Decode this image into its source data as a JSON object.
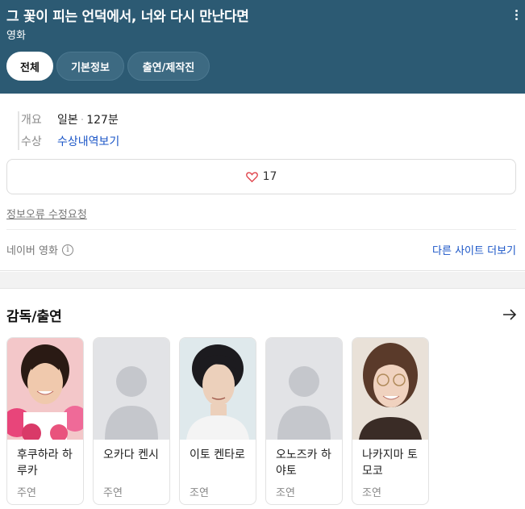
{
  "header": {
    "title": "그 꽃이 피는 언덕에서, 너와 다시 만난다면",
    "subtitle": "영화",
    "tabs": [
      {
        "label": "전체",
        "active": true
      },
      {
        "label": "기본정보",
        "active": false
      },
      {
        "label": "출연/제작진",
        "active": false
      }
    ]
  },
  "info": {
    "overview_key": "개요",
    "country": "일본",
    "separator": "·",
    "runtime": "127분",
    "award_key": "수상",
    "award_link": "수상내역보기",
    "likes": "17",
    "report_link": "정보오류 수정요청",
    "source": "네이버 영화",
    "more_sites": "다른 사이트 더보기"
  },
  "cast": {
    "title": "감독/출연",
    "members": [
      {
        "name": "후쿠하라 하루카",
        "role": "주연",
        "photo": "actress-photo"
      },
      {
        "name": "오카다 켄시",
        "role": "주연",
        "photo": "placeholder"
      },
      {
        "name": "이토 켄타로",
        "role": "조연",
        "photo": "actor-photo"
      },
      {
        "name": "오노즈카 하야토",
        "role": "조연",
        "photo": "placeholder"
      },
      {
        "name": "나카지마 토모코",
        "role": "조연",
        "photo": "actress-photo"
      }
    ]
  },
  "colors": {
    "header_bg": "#2c5a73",
    "link": "#1a55c7",
    "heart": "#e0454d"
  }
}
